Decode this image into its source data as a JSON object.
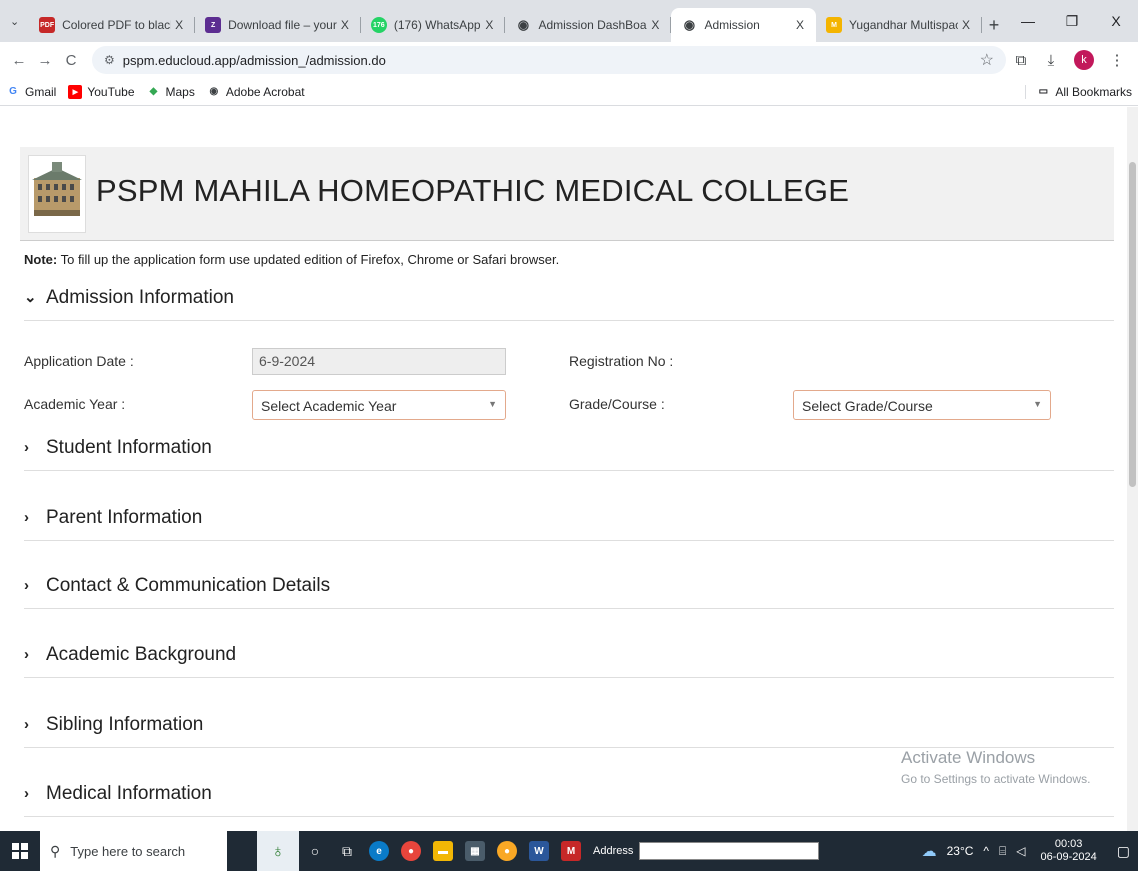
{
  "browser": {
    "tab_list_glyph": "⌄",
    "tabs": [
      {
        "title": "Colored PDF to black",
        "favicon": "PDF",
        "fav_color": "#c62828",
        "close": "X"
      },
      {
        "title": "Download file – your",
        "favicon": "Z",
        "fav_color": "#5c2d91",
        "close": "X"
      },
      {
        "title": "(176) WhatsApp",
        "favicon": "176",
        "fav_color": "#25d366",
        "close": "X"
      },
      {
        "title": "Admission DashBoar",
        "favicon": "◉",
        "fav_color": "#3c4043",
        "close": "X"
      },
      {
        "title": "Admission",
        "favicon": "◉",
        "fav_color": "#3c4043",
        "close": "X"
      },
      {
        "title": "Yugandhar Multispac",
        "favicon": "M",
        "fav_color": "#f4b400",
        "close": "X"
      }
    ],
    "new_tab": "+",
    "window_controls": {
      "minimize": "—",
      "restore": "❐",
      "close": "X"
    },
    "nav": {
      "back": "←",
      "forward": "→",
      "reload": "C"
    },
    "url": "pspm.educloud.app/admission_/admission.do",
    "bookmarks": [
      {
        "label": "Gmail",
        "icon": "G",
        "color": "#4285f4"
      },
      {
        "label": "YouTube",
        "icon": "▶",
        "color": "#ff0000"
      },
      {
        "label": "Maps",
        "icon": "◆",
        "color": "#34a853"
      },
      {
        "label": "Adobe Acrobat",
        "icon": "◉",
        "color": "#3c4043"
      }
    ],
    "all_bookmarks": "All Bookmarks",
    "profile_initial": "k"
  },
  "page": {
    "college_name": "PSPM MAHILA HOMEOPATHIC MEDICAL COLLEGE",
    "note_label": "Note:",
    "note_text": " To fill up the application form use updated edition of Firefox, Chrome or Safari browser.",
    "admission_section": {
      "title": "Admission Information",
      "application_date_label": "Application Date :",
      "application_date_value": "6-9-2024",
      "registration_no_label": "Registration No :",
      "academic_year_label": "Academic Year :",
      "academic_year_selected": "Select Academic Year",
      "grade_course_label": "Grade/Course :",
      "grade_course_selected": "Select Grade/Course"
    },
    "sections": [
      "Student Information",
      "Parent Information",
      "Contact & Communication Details",
      "Academic Background",
      "Sibling Information",
      "Medical Information"
    ],
    "watermark": {
      "line1": "Activate Windows",
      "line2": "Go to Settings to activate Windows."
    }
  },
  "taskbar": {
    "search_placeholder": "Type here to search",
    "address_label": "Address",
    "weather": "23°C",
    "time": "00:03",
    "date": "06-09-2024"
  }
}
